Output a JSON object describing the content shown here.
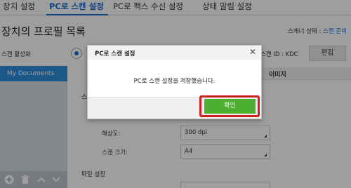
{
  "tabs": [
    {
      "label": "장치 설정"
    },
    {
      "label": "PC로 스캔 설정"
    },
    {
      "label": "PC로 팩스 수신 설정"
    },
    {
      "label": "상태 알림 설정"
    }
  ],
  "active_tab": 1,
  "page": {
    "title": "장치의 프로필 목록",
    "scanner_status_label": "스캐너 상태 : ",
    "scanner_status_value": "스캔 준비"
  },
  "toolbar": {
    "scan_activate_label": "스캔 활성화",
    "scan_id_label": "스캔 ID :  KDC",
    "edit_button": "편집"
  },
  "sidebar": {
    "items": [
      {
        "label": "My Documents"
      }
    ],
    "tools": [
      "add-icon",
      "delete-icon",
      "up-icon",
      "down-icon"
    ]
  },
  "main": {
    "column_header": "이미지",
    "scan_label_partial": "스",
    "resolution_label": "해상도:",
    "resolution_value": "300 dpi",
    "scan_size_label": "스캔 크기:",
    "scan_size_value": "A4",
    "file_settings_label": "파일 설정"
  },
  "dialog": {
    "title": "PC로 스캔 설정",
    "message": "PC로 스캔 설정을 저장했습니다.",
    "ok_button": "확인",
    "close_symbol": "✕"
  },
  "colors": {
    "accent": "#1a6fd0",
    "ok_green": "#4caf2f",
    "highlight_red": "#cc1f1f",
    "sidebar_selected": "#2d8fde"
  }
}
